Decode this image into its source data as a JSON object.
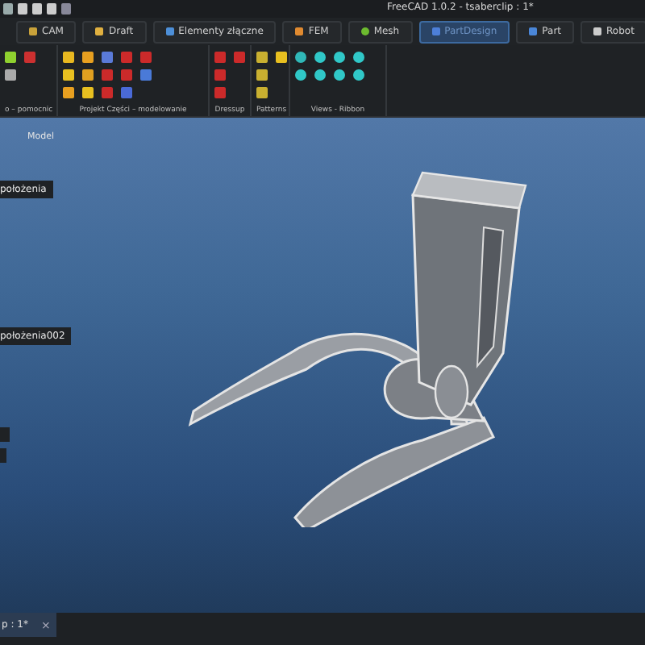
{
  "window": {
    "title": "FreeCAD 1.0.2 - tsaberclip : 1*"
  },
  "workbench_tabs": [
    {
      "label": "CAM",
      "selected": false
    },
    {
      "label": "Draft",
      "selected": false
    },
    {
      "label": "Elementy złączne",
      "selected": false
    },
    {
      "label": "FEM",
      "selected": false
    },
    {
      "label": "Mesh",
      "selected": false
    },
    {
      "label": "PartDesign",
      "selected": true
    },
    {
      "label": "Part",
      "selected": false
    },
    {
      "label": "Robot",
      "selected": false
    }
  ],
  "toolbar_groups": [
    {
      "label": "o – pomocnic"
    },
    {
      "label": "Projekt Części – modelowanie"
    },
    {
      "label": "Dressup"
    },
    {
      "label": "Patterns"
    },
    {
      "label": "Views - Ribbon"
    }
  ],
  "viewport": {
    "panel_title": "Model",
    "labels": [
      {
        "text": "położenia"
      },
      {
        "text": "położenia002"
      }
    ]
  },
  "document_tab": {
    "label": "p : 1*",
    "close": "×"
  }
}
